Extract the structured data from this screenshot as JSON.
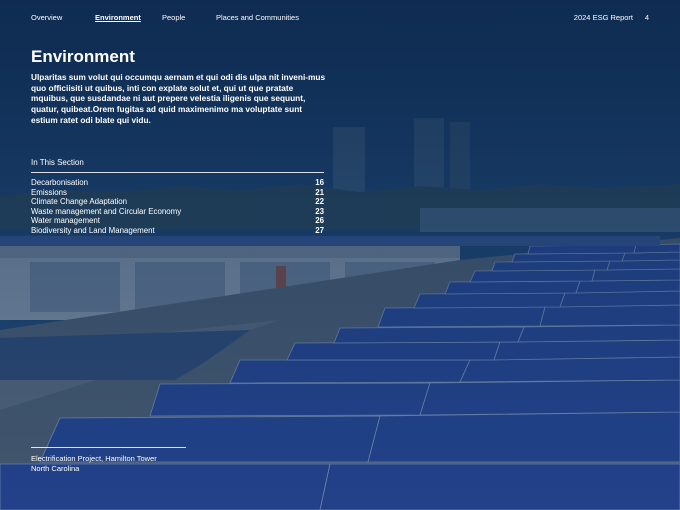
{
  "nav": {
    "items": [
      {
        "label": "Overview",
        "active": false
      },
      {
        "label": "Environment",
        "active": true
      },
      {
        "label": "People",
        "active": false
      },
      {
        "label": "Places and Communities",
        "active": false
      }
    ],
    "report_label": "2024 ESG Report",
    "page_number": "4"
  },
  "title": "Environment",
  "intro": "Ulparitas sum volut qui occumqu aernam et qui odi dis ulpa nit inveni-mus quo officiisiti ut quibus, inti con explate solut et, qui ut que pratate mquibus, que susdandae ni aut prepere velestia iligenis que sequunt, quatur, quibeat.Orem fugitas ad quid maximenimo ma voluptate sunt estium ratet odi blate qui vidu.",
  "section": {
    "heading": "In This Section",
    "items": [
      {
        "label": "Decarbonisation",
        "page": "16"
      },
      {
        "label": "Emissions",
        "page": "21"
      },
      {
        "label": "Climate Change Adaptation",
        "page": "22"
      },
      {
        "label": "Waste management and Circular Economy",
        "page": "23"
      },
      {
        "label": "Water management",
        "page": "26"
      },
      {
        "label": "Biodiversity and Land Management",
        "page": "27"
      }
    ]
  },
  "caption": {
    "line1": "Electrification Project, Hamilton Tower",
    "line2": "North Carolina"
  },
  "photo": {
    "subject": "rooftop-solar-panels",
    "colors": {
      "sky": "#123a63",
      "panel": "#23409a",
      "roof": "#5c6a78",
      "tint": "#0f284b"
    }
  }
}
